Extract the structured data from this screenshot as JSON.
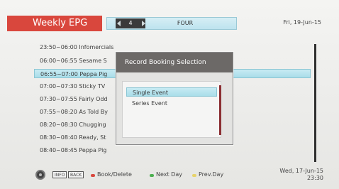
{
  "header": {
    "title": "Weekly EPG",
    "channel_number": "4",
    "channel_name": "FOUR",
    "date": "Fri, 19-Jun-15"
  },
  "programmes": [
    {
      "text": "23:50~06:00 Infomercials"
    },
    {
      "text": "06:00~06:55 Sesame S"
    },
    {
      "text": "06:55~07:00 Peppa Pig",
      "selected": true
    },
    {
      "text": "07:00~07:30 Sticky TV"
    },
    {
      "text": "07:30~07:55 Fairly Odd"
    },
    {
      "text": "07:55~08:20 As Told By"
    },
    {
      "text": "08:20~08:30 Chugging"
    },
    {
      "text": "08:30~08:40 Ready, St"
    },
    {
      "text": "08:40~08:45 Peppa Pig"
    }
  ],
  "dialog": {
    "title": "Record Booking Selection",
    "options": [
      "Single Event",
      "Series Event"
    ],
    "selected_index": 0
  },
  "footer": {
    "keys": [
      "INFO",
      "BACK"
    ],
    "book_delete": "Book/Delete",
    "next_day": "Next Day",
    "prev_day": "Prev.Day",
    "date": "Wed, 17-Jun-15",
    "time": "23:30"
  },
  "colors": {
    "red": "#d9473d",
    "green": "#4caf50",
    "yellow": "#e7d36b",
    "highlight": "#a9dde9"
  }
}
